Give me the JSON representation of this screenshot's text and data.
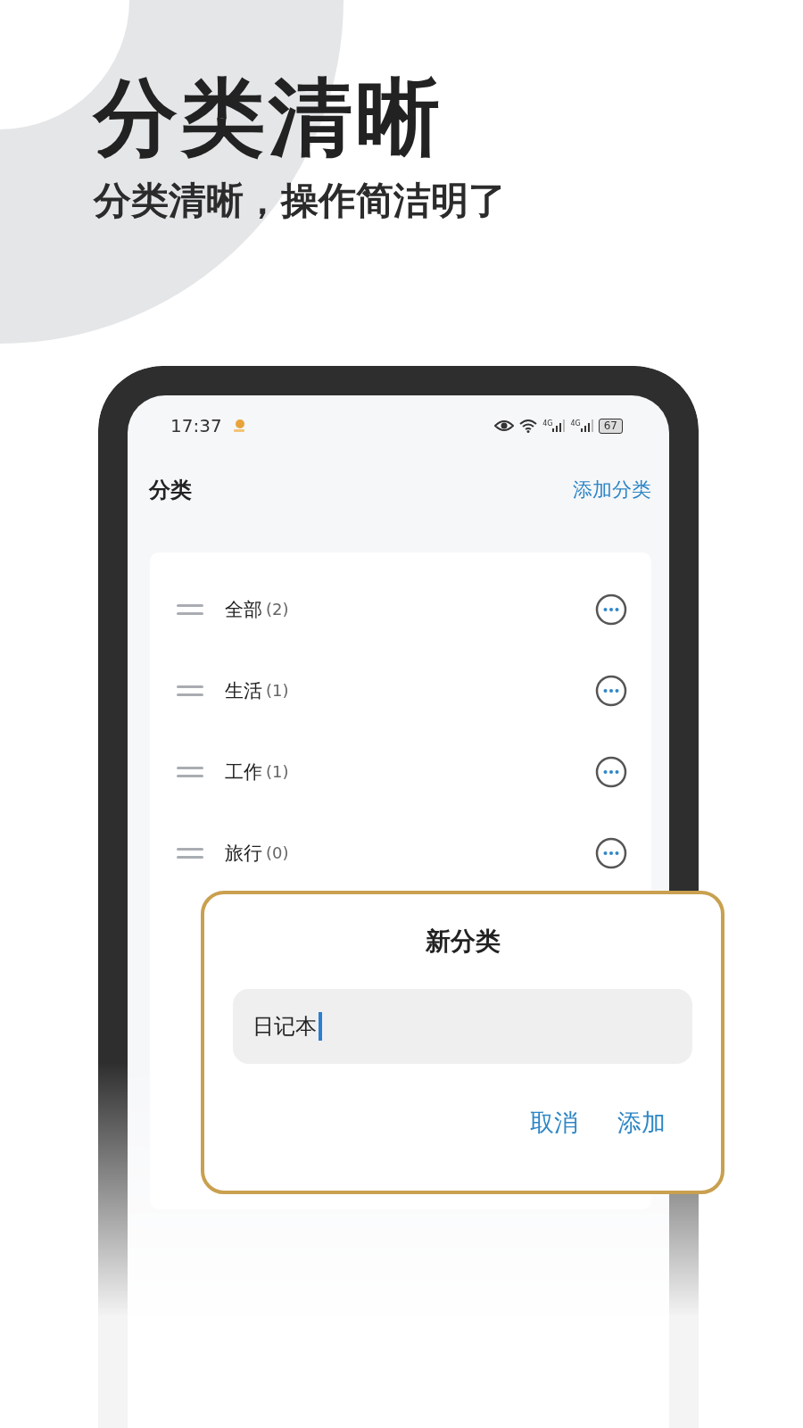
{
  "headline": {
    "title": "分类清晰",
    "subtitle": "分类清晰，操作简洁明了"
  },
  "status_bar": {
    "time": "17:37",
    "networks": [
      "4G",
      "4G"
    ],
    "battery": "67"
  },
  "header": {
    "title": "分类",
    "action": "添加分类"
  },
  "categories": [
    {
      "name": "全部",
      "count": "(2)"
    },
    {
      "name": "生活",
      "count": "(1)"
    },
    {
      "name": "工作",
      "count": "(1)"
    },
    {
      "name": "旅行",
      "count": "(0)"
    }
  ],
  "dialog": {
    "title": "新分类",
    "field": {
      "value": "日记本",
      "focused": true
    },
    "buttons": [
      "取消",
      "添加"
    ]
  }
}
